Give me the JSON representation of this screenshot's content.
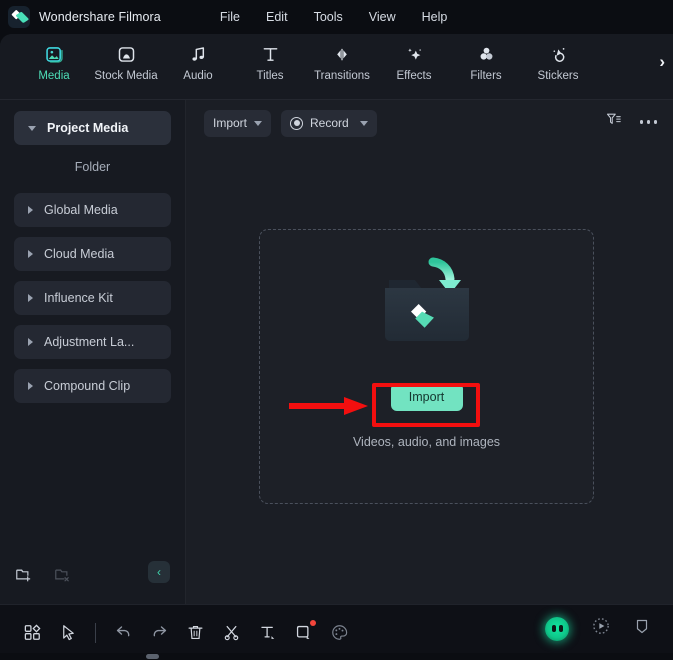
{
  "window": {
    "app_title": "Wondershare Filmora",
    "logo_icon": "filmora-diamond-logo"
  },
  "menubar": {
    "items": [
      {
        "label": "File"
      },
      {
        "label": "Edit"
      },
      {
        "label": "Tools"
      },
      {
        "label": "View"
      },
      {
        "label": "Help"
      }
    ]
  },
  "tabstrip": {
    "tabs": [
      {
        "label": "Media",
        "icon": "image-icon",
        "active": true
      },
      {
        "label": "Stock Media",
        "icon": "stock-media-icon",
        "active": false
      },
      {
        "label": "Audio",
        "icon": "music-note-icon",
        "active": false
      },
      {
        "label": "Titles",
        "icon": "text-t-icon",
        "active": false
      },
      {
        "label": "Transitions",
        "icon": "transitions-arrows-icon",
        "active": false
      },
      {
        "label": "Effects",
        "icon": "magic-wand-sparkle-icon",
        "active": false
      },
      {
        "label": "Filters",
        "icon": "filters-circles-icon",
        "active": false
      },
      {
        "label": "Stickers",
        "icon": "sticker-icon",
        "active": false
      }
    ],
    "more_icon": "chevron-right-icon"
  },
  "sidebar": {
    "items": [
      {
        "label": "Project Media",
        "caret": "down",
        "active": true
      },
      {
        "label": "Global Media",
        "caret": "right",
        "active": false
      },
      {
        "label": "Cloud Media",
        "caret": "right",
        "active": false
      },
      {
        "label": "Influence Kit",
        "caret": "right",
        "active": false
      },
      {
        "label": "Adjustment La...",
        "caret": "right",
        "active": false
      },
      {
        "label": "Compound Clip",
        "caret": "right",
        "active": false
      }
    ],
    "folder_label": "Folder",
    "footer": {
      "new_folder_icon": "folder-add-icon",
      "delete_folder_icon": "folder-delete-icon",
      "collapse_icon": "chevron-left-icon"
    }
  },
  "content_toolbar": {
    "import_label": "Import",
    "import_caret_icon": "chevron-down-icon",
    "record_label": "Record",
    "record_icon": "record-circle-icon",
    "record_caret_icon": "chevron-down-icon",
    "filter_icon": "filter-sort-icon",
    "more_icon": "more-horizontal-icon"
  },
  "dropzone": {
    "illustration_icon": "folder-import-arrow-icon",
    "import_button_label": "Import",
    "subtitle": "Videos, audio, and images"
  },
  "annotation": {
    "highlight_color": "#f30f0f",
    "arrow_icon": "red-pointer-arrow",
    "box_icon": "red-highlight-box"
  },
  "bottom_toolbar": {
    "left_icons": [
      {
        "name": "layout-grid-icon"
      },
      {
        "name": "cursor-select-icon"
      },
      {
        "name": "divider"
      },
      {
        "name": "undo-icon"
      },
      {
        "name": "redo-icon"
      },
      {
        "name": "delete-trash-icon"
      },
      {
        "name": "split-scissors-icon"
      },
      {
        "name": "text-tool-icon"
      },
      {
        "name": "crop-tool-icon",
        "badge": true
      },
      {
        "name": "color-palette-icon"
      }
    ],
    "right_icons": [
      {
        "name": "ai-assistant-icon"
      },
      {
        "name": "render-preview-icon"
      },
      {
        "name": "marker-shield-icon"
      }
    ]
  },
  "colors": {
    "accent_teal": "#4ddcb6",
    "import_button_bg": "#72e3c1",
    "annotation_red": "#f30f0f",
    "panel_bg": "#171a21",
    "content_bg": "#1b1e25"
  }
}
